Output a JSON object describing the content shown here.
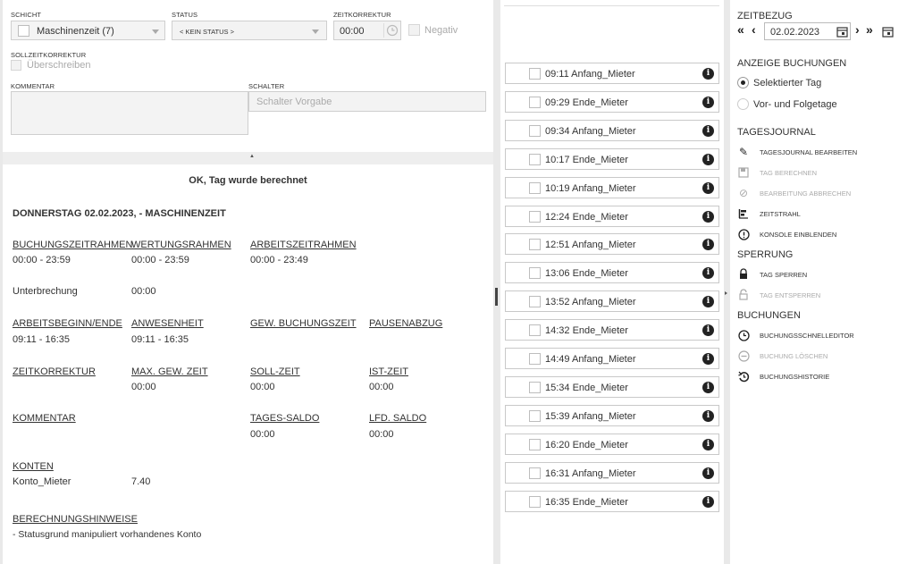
{
  "form": {
    "schicht_label": "SCHICHT",
    "schicht_value": "Maschinenzeit (7)",
    "status_label": "STATUS",
    "status_value": "< KEIN STATUS >",
    "zeitkorrektur_label": "ZEITKORREKTUR",
    "zeitkorrektur_value": "00:00",
    "negativ_label": "Negativ",
    "sollzeitkorrektur_label": "SOLLZEITKORREKTUR",
    "ueberschreiben_label": "Überschreiben",
    "kommentar_label": "KOMMENTAR",
    "schalter_label": "SCHALTER",
    "schalter_placeholder": "Schalter Vorgabe",
    "collapse_glyph": "▲"
  },
  "result": {
    "message": "OK, Tag wurde berechnet",
    "day_title": "DONNERSTAG 02.02.2023, - MASCHINENZEIT",
    "buchungszeitrahmen": {
      "label": "BUCHUNGSZEITRAHMEN",
      "value": "00:00 - 23:59"
    },
    "wertungsrahmen": {
      "label": "WERTUNGSRAHMEN",
      "value": "00:00 - 23:59"
    },
    "arbeitszeitrahmen": {
      "label": "ARBEITSZEITRAHMEN",
      "value": "00:00 - 23:49"
    },
    "unterbrechung": {
      "label": "Unterbrechung",
      "value": "00:00"
    },
    "arbeitsbeginn": {
      "label": "ARBEITSBEGINN/ENDE",
      "value": "09:11 - 16:35"
    },
    "anwesenheit": {
      "label": "ANWESENHEIT",
      "value": "09:11 - 16:35"
    },
    "gew_buchungszeit": {
      "label": "GEW. BUCHUNGSZEIT"
    },
    "pausenabzug": {
      "label": "PAUSENABZUG"
    },
    "zeitkorrektur": {
      "label": "ZEITKORREKTUR"
    },
    "max_gew_zeit": {
      "label": "MAX. GEW. ZEIT",
      "value": "00:00"
    },
    "soll_zeit": {
      "label": "SOLL-ZEIT",
      "value": "00:00"
    },
    "ist_zeit": {
      "label": "IST-ZEIT",
      "value": "00:00"
    },
    "kommentar": {
      "label": "KOMMENTAR"
    },
    "tages_saldo": {
      "label": "TAGES-SALDO",
      "value": "00:00"
    },
    "lfd_saldo": {
      "label": "LFD. SALDO",
      "value": "00:00"
    },
    "konten": {
      "label": "KONTEN",
      "account": "Konto_Mieter",
      "value": "7.40"
    },
    "hinweise": {
      "label": "BERECHNUNGSHINWEISE",
      "text": "- Statusgrund manipuliert vorhandenes Konto"
    }
  },
  "bookings": [
    "09:11 Anfang_Mieter",
    "09:29 Ende_Mieter",
    "09:34 Anfang_Mieter",
    "10:17 Ende_Mieter",
    "10:19 Anfang_Mieter",
    "12:24 Ende_Mieter",
    "12:51 Anfang_Mieter",
    "13:06 Ende_Mieter",
    "13:52 Anfang_Mieter",
    "14:32 Ende_Mieter",
    "14:49 Anfang_Mieter",
    "15:34 Ende_Mieter",
    "15:39 Anfang_Mieter",
    "16:20 Ende_Mieter",
    "16:31 Anfang_Mieter",
    "16:35 Ende_Mieter"
  ],
  "info_glyph": "i",
  "sidebar": {
    "zeitbezug_label": "ZEITBEZUG",
    "date_value": "02.02.2023",
    "nav_first": "«",
    "nav_prev": "‹",
    "nav_next": "›",
    "nav_last": "»",
    "anzeige_label": "ANZEIGE BUCHUNGEN",
    "radio_selected_day": "Selektierter Tag",
    "radio_prev_next": "Vor- und Folgetage",
    "tagesjournal_label": "TAGESJOURNAL",
    "tj_bearbeiten": "TAGESJOURNAL BEARBEITEN",
    "tag_berechnen": "TAG BERECHNEN",
    "bearbeitung_abbrechen": "BEARBEITUNG ABBRECHEN",
    "zeitstrahl": "ZEITSTRAHL",
    "konsole_einblenden": "KONSOLE EINBLENDEN",
    "sperrung_label": "SPERRUNG",
    "tag_sperren": "TAG SPERREN",
    "tag_entsperren": "TAG ENTSPERREN",
    "buchungen_label": "BUCHUNGEN",
    "schnelleditor": "BUCHUNGSSCHNELLEDITOR",
    "buchung_loeschen": "BUCHUNG LÖSCHEN",
    "buchungshistorie": "BUCHUNGSHISTORIE"
  }
}
